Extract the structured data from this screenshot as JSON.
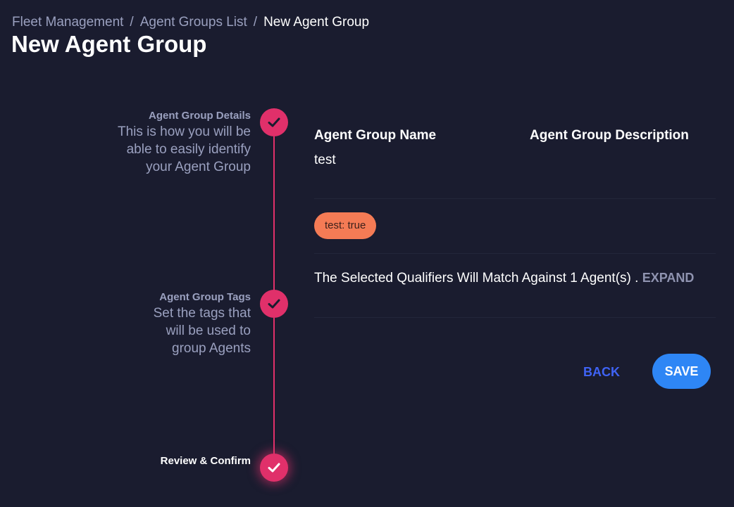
{
  "breadcrumb": {
    "items": [
      "Fleet Management",
      "Agent Groups List"
    ],
    "separator": "/",
    "current": "New Agent Group"
  },
  "page_title": "New Agent Group",
  "stepper": {
    "accent_color": "#e0306a",
    "steps": [
      {
        "title": "Agent Group Details",
        "description": "This is how you will be able to easily identify your Agent Group",
        "status": "complete",
        "icon": "check-icon"
      },
      {
        "title": "Agent Group Tags",
        "description": "Set the tags that will be used to group Agents",
        "status": "complete",
        "icon": "check-icon"
      },
      {
        "title": "Review & Confirm",
        "description": "",
        "status": "active",
        "icon": "check-icon"
      }
    ]
  },
  "review": {
    "name_label": "Agent Group Name",
    "name_value": "test",
    "description_label": "Agent Group Description",
    "description_value": "",
    "tags": [
      "test: true"
    ],
    "tag_color": "#f47b55",
    "match_text": "The Selected Qualifiers Will Match Against 1 Agent(s) .",
    "expand_label": "EXPAND"
  },
  "actions": {
    "back_label": "BACK",
    "save_label": "SAVE",
    "save_color": "#2e86f5",
    "back_color": "#3f63f5"
  }
}
